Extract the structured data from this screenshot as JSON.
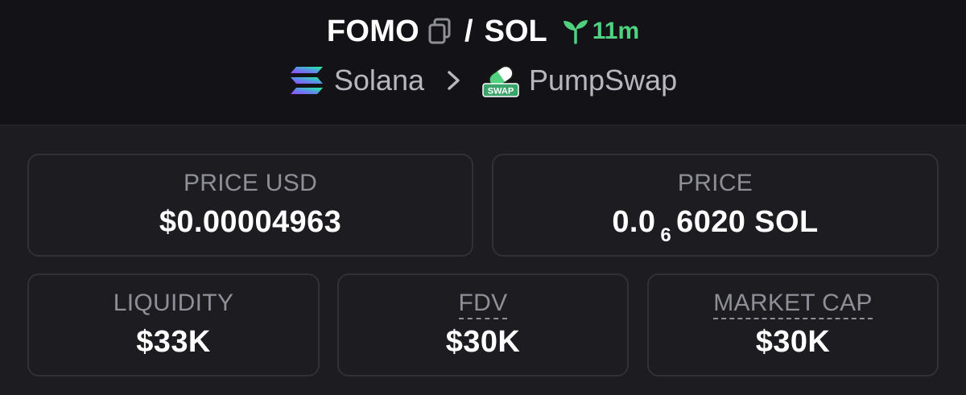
{
  "header": {
    "base_token": "FOMO",
    "separator": "/",
    "quote_token": "SOL",
    "age": "11m",
    "chain": "Solana",
    "dex": "PumpSwap",
    "dex_badge": "SWAP"
  },
  "stats": {
    "price_usd_label": "PRICE USD",
    "price_usd_value": "$0.00004963",
    "price_label": "PRICE",
    "price_prefix": "0.0",
    "price_zero_count": "6",
    "price_suffix": "6020 SOL",
    "liquidity_label": "LIQUIDITY",
    "liquidity_value": "$33K",
    "fdv_label": "FDV",
    "fdv_value": "$30K",
    "market_cap_label": "MARKET CAP",
    "market_cap_value": "$30K"
  },
  "colors": {
    "background": "#1c1c21",
    "header_background": "#131317",
    "card_border": "#303036",
    "label": "#8f8f98",
    "age_green": "#4fd17f"
  },
  "icons": {
    "copy": "copy-icon",
    "age": "sprout-icon",
    "chain": "solana-logo-icon",
    "separator": "chevron-right-icon",
    "dex": "pumpswap-logo-icon"
  }
}
